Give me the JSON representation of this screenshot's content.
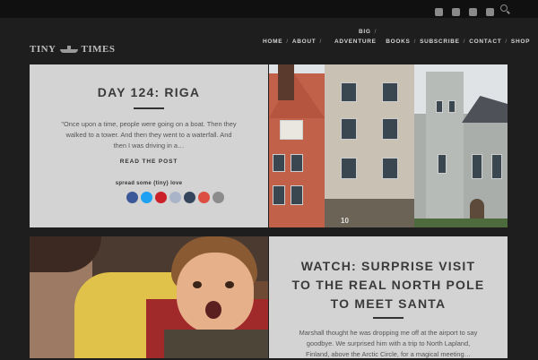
{
  "brand": {
    "logo_left": "TINY",
    "logo_right": "TIMES"
  },
  "social": [
    "twitter-icon",
    "facebook-icon",
    "youtube-icon",
    "instagram-icon",
    "search-icon"
  ],
  "nav": {
    "big": "BIG",
    "home": "HOME",
    "about": "ABOUT",
    "adventure": "ADVENTURE",
    "books": "BOOKS",
    "subscribe": "SUBSCRIBE",
    "contact": "CONTACT",
    "shop": "SHOP",
    "separator": "/"
  },
  "post1": {
    "title": "DAY 124: RIGA",
    "excerpt_lines": [
      "\"Once upon a time, people were going on a boat. Then they",
      "walked to a tower. And then they went to a waterfall. And",
      "then I was driving in a…"
    ],
    "read_more": "READ THE POST",
    "spread_love": "spread some {tiny} love",
    "share_icons": [
      "facebook-share-icon",
      "twitter-share-icon",
      "pinterest-share-icon",
      "reddit-share-icon",
      "tumblr-share-icon",
      "google-plus-share-icon",
      "email-share-icon"
    ],
    "share_colors": [
      "#3b5998",
      "#1da1f2",
      "#cb2027",
      "#aab4c8",
      "#35465c",
      "#dc4e41",
      "#8c8c8c"
    ],
    "photo_sign": "10"
  },
  "post2": {
    "title_lines": [
      "WATCH: SURPRISE VISIT",
      "TO THE REAL NORTH POLE",
      "TO MEET SANTA"
    ],
    "excerpt_lines": [
      "Marshall thought he was dropping me off at the airport to say",
      "goodbye. We surprised him with a trip to North Lapland,",
      "Finland, above the Arctic Circle, for a magical meeting…"
    ]
  }
}
